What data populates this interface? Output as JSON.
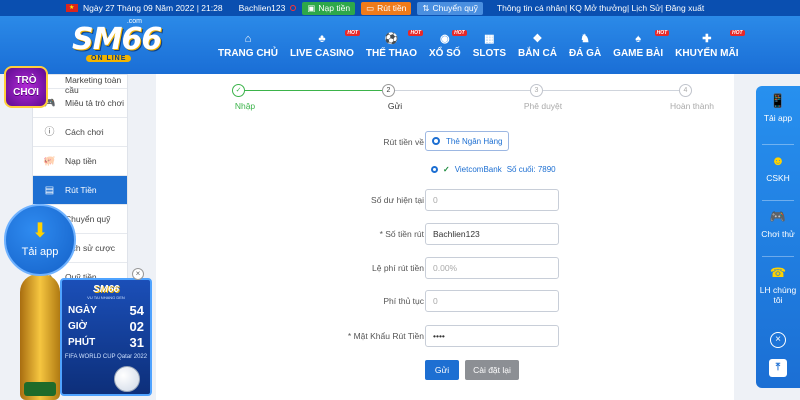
{
  "topbar": {
    "date": "Ngày 27 Tháng 09 Năm 2022 | 21:28",
    "username": "Bachlien123",
    "deposit": "Nạp tiền",
    "withdraw": "Rút tiền",
    "transfer": "Chuyển quỹ",
    "links": "Thông tin cá nhân| KQ Mở thưởng| Lịch Sử| Đăng xuất"
  },
  "logo": {
    "brand": "SM66",
    "com": ".com",
    "tagline": "ON LINE"
  },
  "nav": [
    {
      "label": "TRANG CHỦ",
      "icon": "⌂",
      "hot": ""
    },
    {
      "label": "LIVE CASINO",
      "icon": "♣",
      "hot": "HOT"
    },
    {
      "label": "THỂ THAO",
      "icon": "⚽",
      "hot": "HOT"
    },
    {
      "label": "XỔ SỐ",
      "icon": "◉",
      "hot": "HOT"
    },
    {
      "label": "SLOTS",
      "icon": "▦",
      "hot": ""
    },
    {
      "label": "BẮN CÁ",
      "icon": "❖",
      "hot": ""
    },
    {
      "label": "ĐÁ GÀ",
      "icon": "♞",
      "hot": ""
    },
    {
      "label": "GAME BÀI",
      "icon": "♠",
      "hot": "HOT"
    },
    {
      "label": "KHUYẾN MÃI",
      "icon": "✚",
      "hot": "HOT"
    }
  ],
  "sidebar": {
    "items": [
      {
        "label": "Marketing toàn cầu",
        "icon": ""
      },
      {
        "label": "Miêu tả trò chơi",
        "icon": "🎮"
      },
      {
        "label": "Cách chơi",
        "icon": "ⓘ"
      },
      {
        "label": "Nạp tiền",
        "icon": "🐖"
      },
      {
        "label": "Rút Tiền",
        "icon": "▤"
      },
      {
        "label": "Chuyển quỹ",
        "icon": "⇄"
      },
      {
        "label": "Lịch sử cược",
        "icon": "☰"
      },
      {
        "label": "Quỹ tiền",
        "icon": "◔"
      }
    ]
  },
  "steps": [
    {
      "label": "Nhập",
      "num": "✓",
      "state": "done"
    },
    {
      "label": "Gửi",
      "num": "2",
      "state": "current"
    },
    {
      "label": "Phê duyệt",
      "num": "3",
      "state": "future"
    },
    {
      "label": "Hoàn thành",
      "num": "4",
      "state": "future"
    }
  ],
  "form": {
    "withdraw_to_label": "Rút tiền về",
    "withdraw_to_option": "Thẻ Ngân Hàng",
    "bank_name": "VietcomBank",
    "bank_last": "Số cuối:  7890",
    "balance_label": "Số dư hiện tại",
    "balance_value": "0",
    "amount_label": "* Số tiền rút",
    "amount_value": "Bachlien123",
    "fee_rate_label": "Lệ phí rút tiền",
    "fee_rate_value": "0.00%",
    "fee_label": "Phí thủ tục",
    "fee_value": "0",
    "password_label": "* Mật Khẩu Rút Tiền",
    "password_value": "••••",
    "submit": "Gửi",
    "reset": "Cài đặt lại"
  },
  "right_sidebar": {
    "app": "Tải app",
    "cskh": "CSKH",
    "play": "Chơi thử",
    "contact": "LH chúng tôi"
  },
  "floating": {
    "tai_app": "Tải app",
    "tro_choi_1": "TRÒ",
    "tro_choi_2": "CHƠI"
  },
  "countdown": {
    "brand": "SM66",
    "subtitle": "VU TAI NHANG DEN",
    "days_label": "NGÀY",
    "days": "54",
    "hours_label": "GIỜ",
    "hours": "02",
    "minutes_label": "PHÚT",
    "minutes": "31",
    "footer": "FIFA WORLD CUP Qatar 2022"
  }
}
